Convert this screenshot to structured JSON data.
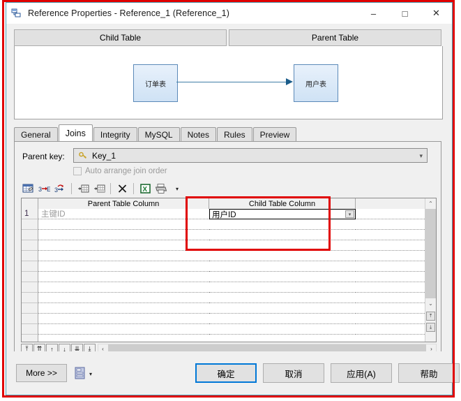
{
  "window": {
    "title": "Reference Properties - Reference_1 (Reference_1)",
    "icon": "reference-icon",
    "controls": {
      "minimize": "–",
      "maximize": "□",
      "close": "✕"
    },
    "frame_color": "#4a9fb5"
  },
  "annotation": {
    "color": "#e00000",
    "target": "child-table-column"
  },
  "table_buttons": {
    "child": "Child Table",
    "parent": "Parent Table"
  },
  "diagram": {
    "child_entity": "订单表",
    "parent_entity": "用户表",
    "relation": "arrow-child-to-parent",
    "box_fill": "#cfe2f5",
    "box_border": "#5b89b8",
    "line_color": "#3f7fa6"
  },
  "tabs": [
    {
      "label": "General",
      "active": false
    },
    {
      "label": "Joins",
      "active": true
    },
    {
      "label": "Integrity",
      "active": false
    },
    {
      "label": "MySQL",
      "active": false
    },
    {
      "label": "Notes",
      "active": false
    },
    {
      "label": "Rules",
      "active": false
    },
    {
      "label": "Preview",
      "active": false
    }
  ],
  "joins": {
    "parent_key_label": "Parent key:",
    "parent_key_value": "Key_1",
    "parent_key_icon": "key-icon",
    "parent_key_arrow": "▾",
    "auto_arrange_label": "Auto arrange join order",
    "auto_arrange_checked": false,
    "auto_arrange_enabled": false,
    "toolbar": [
      {
        "name": "edit-grid-icon"
      },
      {
        "name": "add-join-icon"
      },
      {
        "name": "remove-join-icon"
      },
      {
        "name": "insert-row-icon"
      },
      {
        "name": "append-row-icon"
      },
      {
        "name": "delete-row-icon",
        "glyph": "✕"
      },
      {
        "name": "export-excel-icon",
        "glyph": "X"
      },
      {
        "name": "print-icon"
      },
      {
        "name": "print-dropdown-icon",
        "glyph": "▾"
      }
    ],
    "grid": {
      "columns": [
        "",
        "Parent Table Column",
        "Child Table Column",
        ""
      ],
      "rows": [
        {
          "num": "1",
          "parent_column": "主键ID",
          "child_column": "用户ID",
          "selected": true
        },
        {
          "num": "",
          "parent_column": "",
          "child_column": "",
          "selected": false
        },
        {
          "num": "",
          "parent_column": "",
          "child_column": "",
          "selected": false
        },
        {
          "num": "",
          "parent_column": "",
          "child_column": "",
          "selected": false
        },
        {
          "num": "",
          "parent_column": "",
          "child_column": "",
          "selected": false
        },
        {
          "num": "",
          "parent_column": "",
          "child_column": "",
          "selected": false
        },
        {
          "num": "",
          "parent_column": "",
          "child_column": "",
          "selected": false
        },
        {
          "num": "",
          "parent_column": "",
          "child_column": "",
          "selected": false
        },
        {
          "num": "",
          "parent_column": "",
          "child_column": "",
          "selected": false
        },
        {
          "num": "",
          "parent_column": "",
          "child_column": "",
          "selected": false
        },
        {
          "num": "",
          "parent_column": "",
          "child_column": "",
          "selected": false
        },
        {
          "num": "",
          "parent_column": "",
          "child_column": "",
          "selected": false
        },
        {
          "num": "",
          "parent_column": "",
          "child_column": "",
          "selected": false
        }
      ],
      "cell_dropdown_glyph": "▾"
    },
    "nav": {
      "buttons": [
        {
          "name": "first-record-button",
          "glyph": "⤒"
        },
        {
          "name": "prev-page-button",
          "glyph": "⇈"
        },
        {
          "name": "prev-record-button",
          "glyph": "↑"
        },
        {
          "name": "next-record-button",
          "glyph": "↓"
        },
        {
          "name": "next-page-button",
          "glyph": "⇊"
        },
        {
          "name": "last-record-button",
          "glyph": "⤓"
        }
      ],
      "hscroll_left": "‹",
      "hscroll_right": "›"
    },
    "vscroll": {
      "up": "⌃",
      "down": "⌄",
      "top_button": "⤒",
      "bottom_button": "⤓"
    }
  },
  "footer": {
    "more_label": "More >>",
    "script_icon": "script-list-icon",
    "script_arrow": "▾",
    "buttons": [
      {
        "name": "ok-button",
        "label": "确定",
        "default": true
      },
      {
        "name": "cancel-button",
        "label": "取消",
        "default": false
      },
      {
        "name": "apply-button",
        "label": "应用(A)",
        "default": false
      },
      {
        "name": "help-button",
        "label": "帮助",
        "default": false
      }
    ]
  }
}
